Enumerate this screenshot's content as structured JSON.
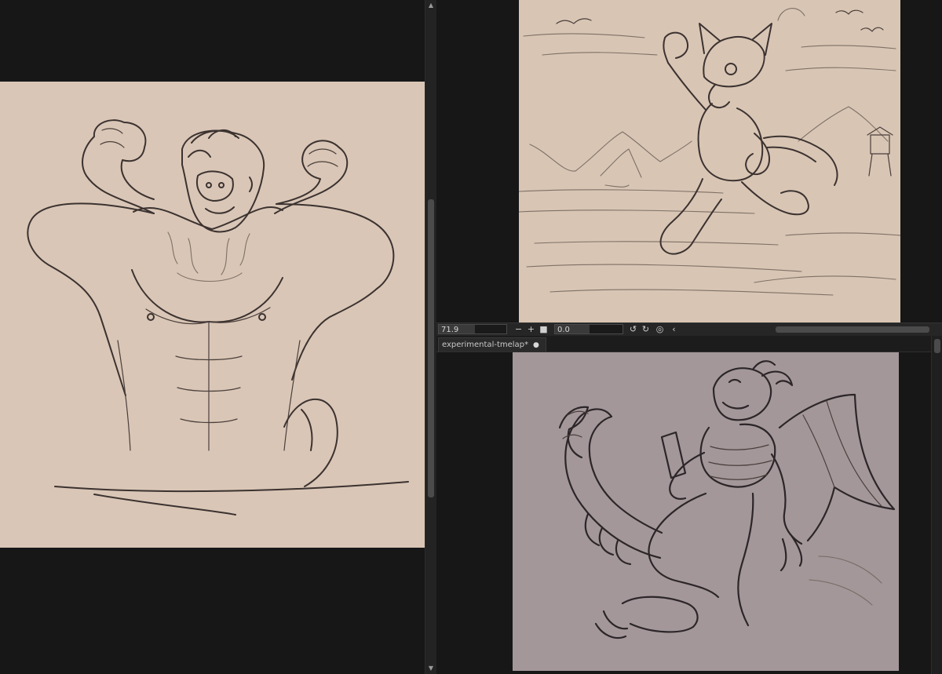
{
  "colors": {
    "workspace_bg": "#171717",
    "canvas_warm": "#d9c6b6",
    "canvas_beach": "#d8c5b4",
    "canvas_mauve": "#a3979a",
    "ink": "#3b3230"
  },
  "panes": {
    "left": {
      "canvas_name": "muscle-flex-sketch"
    },
    "top_right": {
      "canvas_name": "beach-run-sketch"
    },
    "bottom_right": {
      "canvas_name": "dragon-phone-sketch"
    }
  },
  "controls": {
    "zoom_value": "71.9",
    "zoom_out_icon": "minus-icon",
    "zoom_in_icon": "plus-icon",
    "reset_icon": "square-icon",
    "rotation_value": "0.0",
    "rotate_ccw_icon": "rotate-left-icon",
    "rotate_cw_icon": "rotate-right-icon",
    "reset_rotation_icon": "reset-rotation-icon",
    "collapse_icon": "chevron-left-icon"
  },
  "document_tab": {
    "title": "experimental-tmelap*",
    "modified_icon": "modified-dot-icon"
  }
}
